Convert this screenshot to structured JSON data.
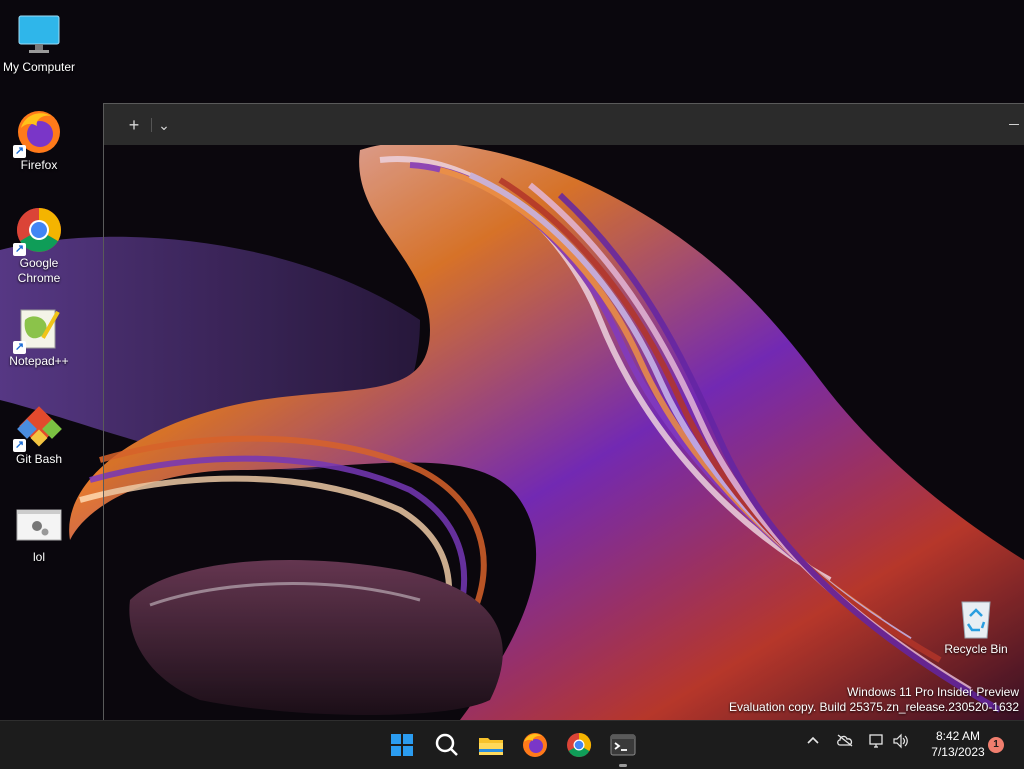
{
  "desktop_icons": [
    {
      "label": "My Computer",
      "icon": "monitor-icon",
      "shortcut": false
    },
    {
      "label": "Firefox",
      "icon": "firefox-icon",
      "shortcut": true
    },
    {
      "label": "Google Chrome",
      "icon": "chrome-icon",
      "shortcut": true
    },
    {
      "label": "Notepad++",
      "icon": "notepadpp-icon",
      "shortcut": true
    },
    {
      "label": "Git Bash",
      "icon": "git-icon",
      "shortcut": true
    },
    {
      "label": "lol",
      "icon": "settings-file-icon",
      "shortcut": false
    }
  ],
  "terminal": {
    "new_tab_label": "+",
    "dropdown_label": "⌄"
  },
  "recycle_bin": {
    "label": "Recycle Bin"
  },
  "watermark": {
    "line1": "Windows 11 Pro Insider Preview",
    "line2": "Evaluation copy. Build 25375.zn_release.230520-1632"
  },
  "taskbar": {
    "apps": [
      "start-icon",
      "search-icon",
      "file-explorer-icon",
      "firefox-icon",
      "chrome-icon",
      "terminal-icon"
    ],
    "clock": {
      "time": "8:42 AM",
      "date": "7/13/2023"
    },
    "notification_count": "1"
  },
  "colors": {
    "taskbar": "#1c1c1c",
    "accent": "#0a74d8"
  }
}
